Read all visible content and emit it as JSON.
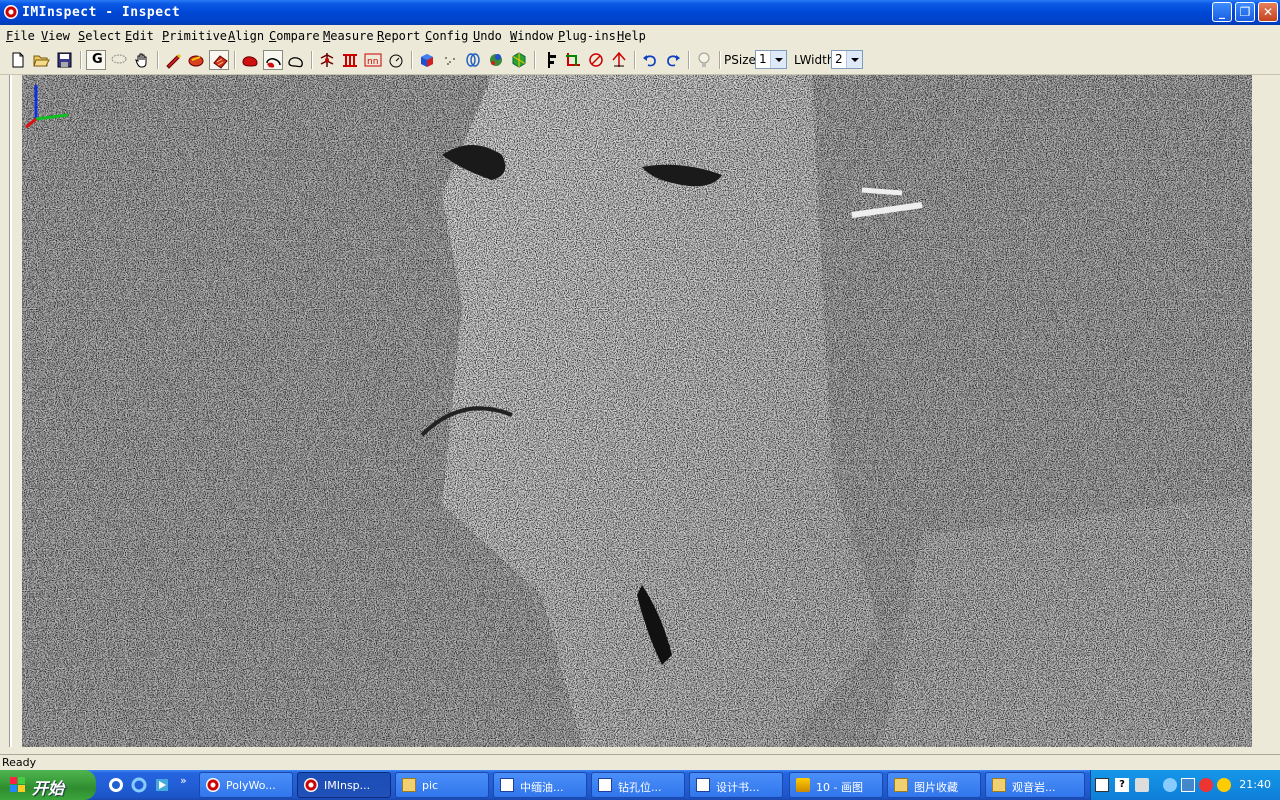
{
  "window": {
    "title": "IMInspect - Inspect",
    "minimize_label": "_",
    "maximize_label": "❐",
    "close_label": "✕"
  },
  "menu": [
    "File",
    "View",
    "Select",
    "Edit",
    "Primitive",
    "Align",
    "Compare",
    "Measure",
    "Report",
    "Config",
    "Undo",
    "Window",
    "Plug-ins",
    "Help"
  ],
  "toolbar": {
    "psize_label": "PSize",
    "psize_value": "1",
    "lwidth_label": "LWidth",
    "lwidth_value": "2",
    "g_label": "G",
    "icons": [
      "new-file-icon",
      "open-folder-icon",
      "save-icon",
      "g-mode-icon",
      "lasso-select-icon",
      "pan-hand-icon",
      "paint-brush-icon",
      "paint-select-icon",
      "paint-block-icon",
      "red-blob-icon",
      "red-lasso-icon",
      "lasso-outline-icon",
      "structure-icon",
      "red-columns-icon",
      "red-nn-icon",
      "circle-target-icon",
      "cube-colored-icon",
      "points-icon",
      "rings-icon",
      "mesh-icon",
      "green-hex-icon",
      "align-icon",
      "crop-icon",
      "curve-icon",
      "red-arrow-up-icon",
      "undo-icon",
      "redo-icon",
      "lightbulb-icon"
    ]
  },
  "status": {
    "text": "Ready"
  },
  "taskbar": {
    "start_label": "开始",
    "tasks": [
      {
        "label": "PolyWo...",
        "icon": "polyworks-icon"
      },
      {
        "label": "IMInsp...",
        "icon": "polyworks-icon",
        "active": true
      },
      {
        "label": "pic",
        "icon": "folder-icon"
      },
      {
        "label": "中缅油...",
        "icon": "word-icon"
      },
      {
        "label": "钻孔位...",
        "icon": "word-icon"
      },
      {
        "label": "设计书...",
        "icon": "word-icon"
      },
      {
        "label": "10 - 画图",
        "icon": "paint-icon"
      },
      {
        "label": "图片收藏",
        "icon": "folder-icon"
      },
      {
        "label": "观音岩...",
        "icon": "folder-icon"
      }
    ],
    "clock": "21:40"
  }
}
